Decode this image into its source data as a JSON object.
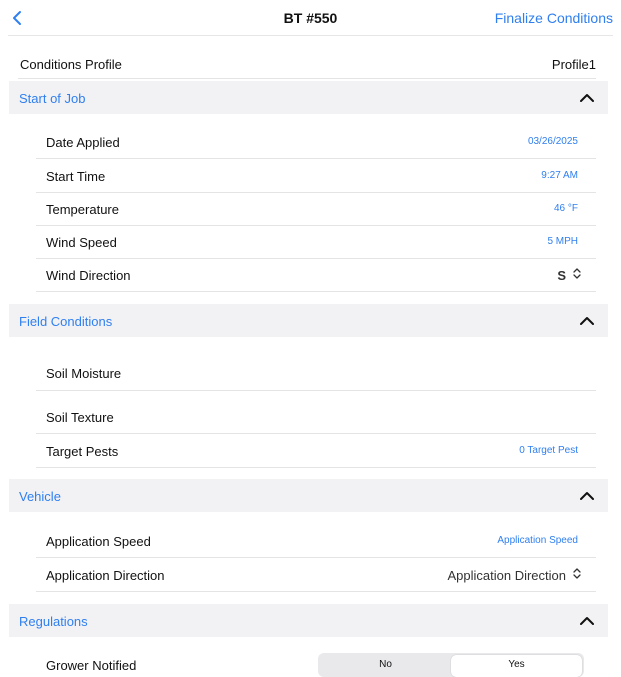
{
  "nav": {
    "title": "BT #550",
    "action": "Finalize Conditions"
  },
  "profile": {
    "label": "Conditions Profile",
    "value": "Profile1"
  },
  "start_of_job": {
    "title": "Start of Job",
    "date_applied": {
      "label": "Date Applied",
      "value": "03/26/2025"
    },
    "start_time": {
      "label": "Start Time",
      "value": "9:27 AM"
    },
    "temperature": {
      "label": "Temperature",
      "value": "46 °F"
    },
    "wind_speed": {
      "label": "Wind Speed",
      "value": "5 MPH"
    },
    "wind_direction": {
      "label": "Wind Direction",
      "value": "S"
    }
  },
  "field_conditions": {
    "title": "Field Conditions",
    "soil_moisture": {
      "label": "Soil Moisture"
    },
    "soil_texture": {
      "label": "Soil Texture"
    },
    "target_pests": {
      "label": "Target Pests",
      "value": "0 Target Pest"
    }
  },
  "vehicle": {
    "title": "Vehicle",
    "application_speed": {
      "label": "Application Speed",
      "value": "Application Speed"
    },
    "application_direction": {
      "label": "Application Direction",
      "value": "Application Direction"
    }
  },
  "regulations": {
    "title": "Regulations",
    "grower_notified": {
      "label": "Grower Notified",
      "options": [
        "No",
        "Yes"
      ],
      "selected": "Yes"
    }
  },
  "colors": {
    "accent": "#2f7ff0",
    "section_bg": "#f2f2f4",
    "divider": "#e4e4e6"
  },
  "icons": {
    "back": "chevron-left-icon",
    "collapse": "chevron-up-icon",
    "picker": "up-down-chevron-icon"
  }
}
